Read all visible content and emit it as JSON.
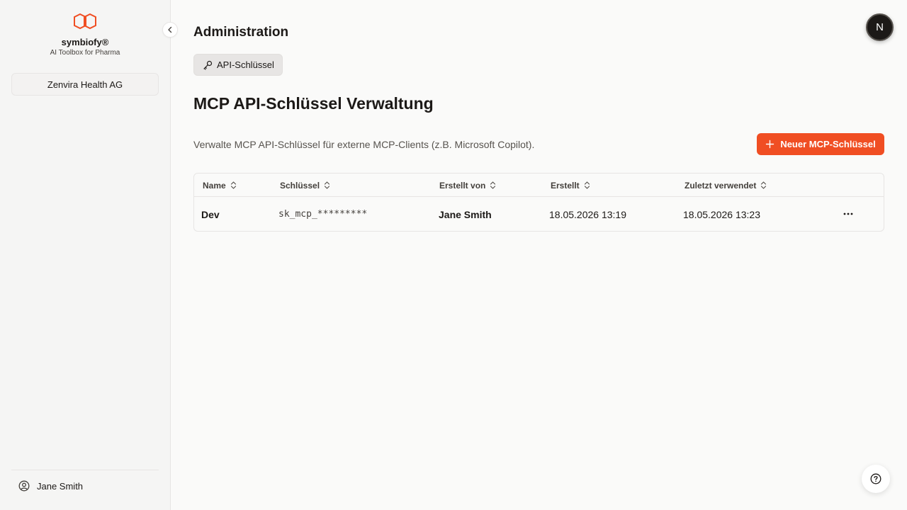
{
  "sidebar": {
    "brand_name": "symbiofy®",
    "brand_tagline": "AI Toolbox for Pharma",
    "organization": "Zenvira Health AG",
    "user_name": "Jane Smith",
    "logo_icon": "interlocking-hexagons-logo",
    "user_icon": "user-circle-icon",
    "collapse_icon": "chevron-left-icon"
  },
  "header": {
    "title": "Administration",
    "tab_label": "API-Schlüssel",
    "tab_icon": "key-icon"
  },
  "main": {
    "page_title": "MCP API-Schlüssel Verwaltung",
    "description": "Verwalte MCP API-Schlüssel für externe MCP-Clients (z.B. Microsoft Copilot).",
    "new_button_label": "Neuer MCP-Schlüssel",
    "new_button_icon": "plus-icon"
  },
  "table": {
    "columns": [
      "Name",
      "Schlüssel",
      "Erstellt von",
      "Erstellt",
      "Zuletzt verwendet"
    ],
    "rows": [
      {
        "name": "Dev",
        "key": "sk_mcp_*********",
        "created_by": "Jane Smith",
        "created": "18.05.2026 13:19",
        "last_used": "18.05.2026 13:23"
      }
    ]
  },
  "floating": {
    "avatar_letter": "N",
    "help_icon": "question-circle-icon"
  },
  "colors": {
    "accent": "#f04e23",
    "sidebar_bg": "#f5f5f4",
    "page_bg": "#fafaf9",
    "text": "#1c1917"
  }
}
